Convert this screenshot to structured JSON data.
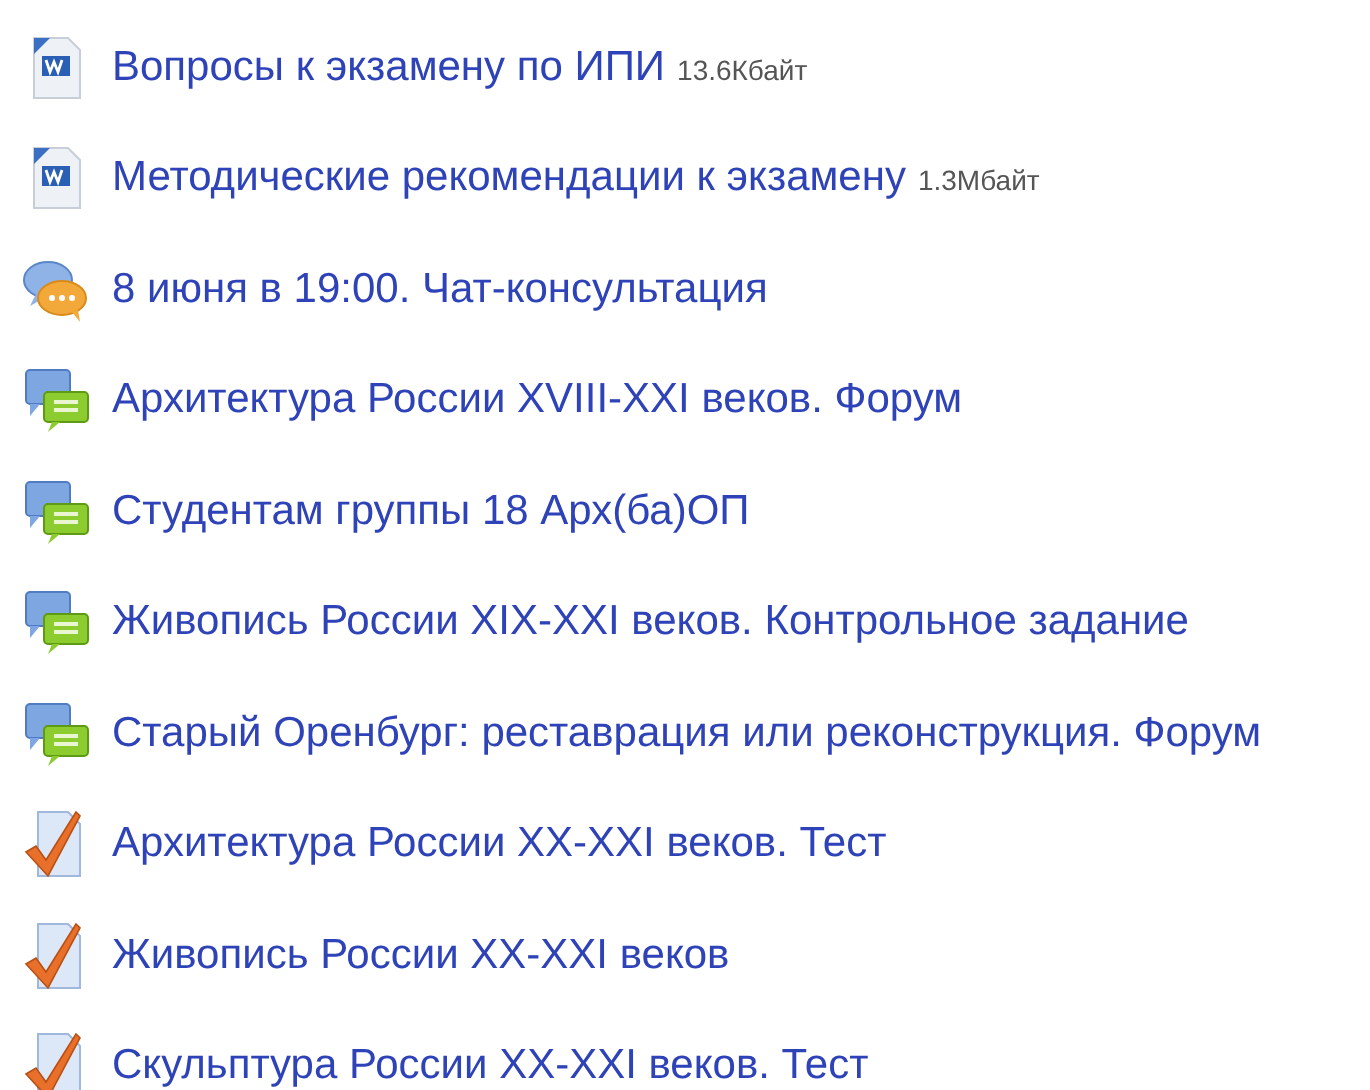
{
  "items": [
    {
      "kind": "document",
      "title": "Вопросы к экзамену по ИПИ",
      "size": "13.6Кбайт"
    },
    {
      "kind": "document",
      "title": "Методические рекомендации к экзамену",
      "size": "1.3Мбайт"
    },
    {
      "kind": "chat",
      "title": "8 июня в 19:00. Чат-консультация"
    },
    {
      "kind": "forum",
      "title": "Архитектура России XVIII-XXI веков. Форум"
    },
    {
      "kind": "forum",
      "title": "Студентам группы 18 Арх(ба)ОП"
    },
    {
      "kind": "forum",
      "title": "Живопись России XIX-XXI веков. Контрольное задание"
    },
    {
      "kind": "forum",
      "title": "Старый Оренбург: реставрация или реконструкция. Форум"
    },
    {
      "kind": "quiz",
      "title": "Архитектура России XX-XXI веков. Тест"
    },
    {
      "kind": "quiz",
      "title": "Живопись России XX-XXI веков"
    },
    {
      "kind": "quiz",
      "title": "Скульптура России XX-XXI веков. Тест"
    }
  ]
}
